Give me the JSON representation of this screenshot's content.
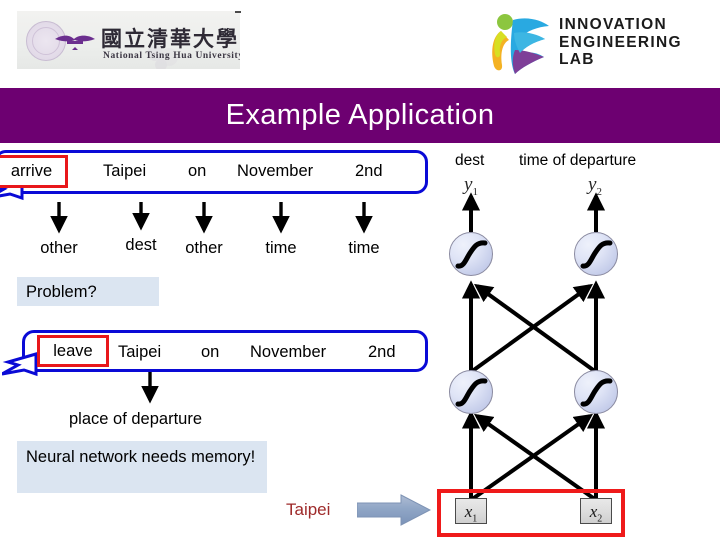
{
  "header": {
    "university_logo": {
      "name": "national-tsing-hua-university",
      "chinese_name": "國立清華大學",
      "english_name": "National Tsing Hua University"
    },
    "lab_logo": {
      "name": "innovation-engineering-lab",
      "text": "INNOVATION\nENGINEERING\nLAB"
    }
  },
  "title": {
    "text": "Example Application",
    "band_color": "#6d0071",
    "text_color": "#ffffff"
  },
  "sentence_1": {
    "tokens": [
      {
        "text": "arrive",
        "boxed": true
      },
      {
        "text": "Taipei",
        "boxed": false
      },
      {
        "text": "on",
        "boxed": false
      },
      {
        "text": "November",
        "boxed": false
      },
      {
        "text": "2nd",
        "boxed": false
      }
    ],
    "slot_labels": [
      "other",
      "dest",
      "other",
      "time",
      "time"
    ]
  },
  "sentence_2": {
    "tokens": [
      {
        "text": "leave",
        "boxed": true
      },
      {
        "text": "Taipei",
        "boxed": false
      },
      {
        "text": "on",
        "boxed": false
      },
      {
        "text": "November",
        "boxed": false
      },
      {
        "text": "2nd",
        "boxed": false
      }
    ],
    "slot_labels": [
      "place of departure"
    ]
  },
  "notes": {
    "problem": "Problem?",
    "memory": "Neural network needs memory!"
  },
  "input_flow": {
    "word": "Taipei",
    "word_color": "#9e2a2a",
    "arrow": "block-right-arrow",
    "arrow_color": "#8ba3c7"
  },
  "network": {
    "output_labels": [
      "dest",
      "time of departure"
    ],
    "output_vars": [
      {
        "base": "y",
        "sub": "1"
      },
      {
        "base": "y",
        "sub": "2"
      }
    ],
    "input_vars": [
      {
        "base": "x",
        "sub": "1"
      },
      {
        "base": "x",
        "sub": "2"
      }
    ],
    "neuron_activation": "sigmoid",
    "layers": [
      "input",
      "hidden",
      "output"
    ],
    "neuron_fill": "#ccd4ee",
    "highlight_color": "#ef1a1a"
  },
  "colors": {
    "bubble_border": "#0a0ad6",
    "token_box_border": "#e8171b",
    "highlight_bg": "#dbe5f1"
  }
}
